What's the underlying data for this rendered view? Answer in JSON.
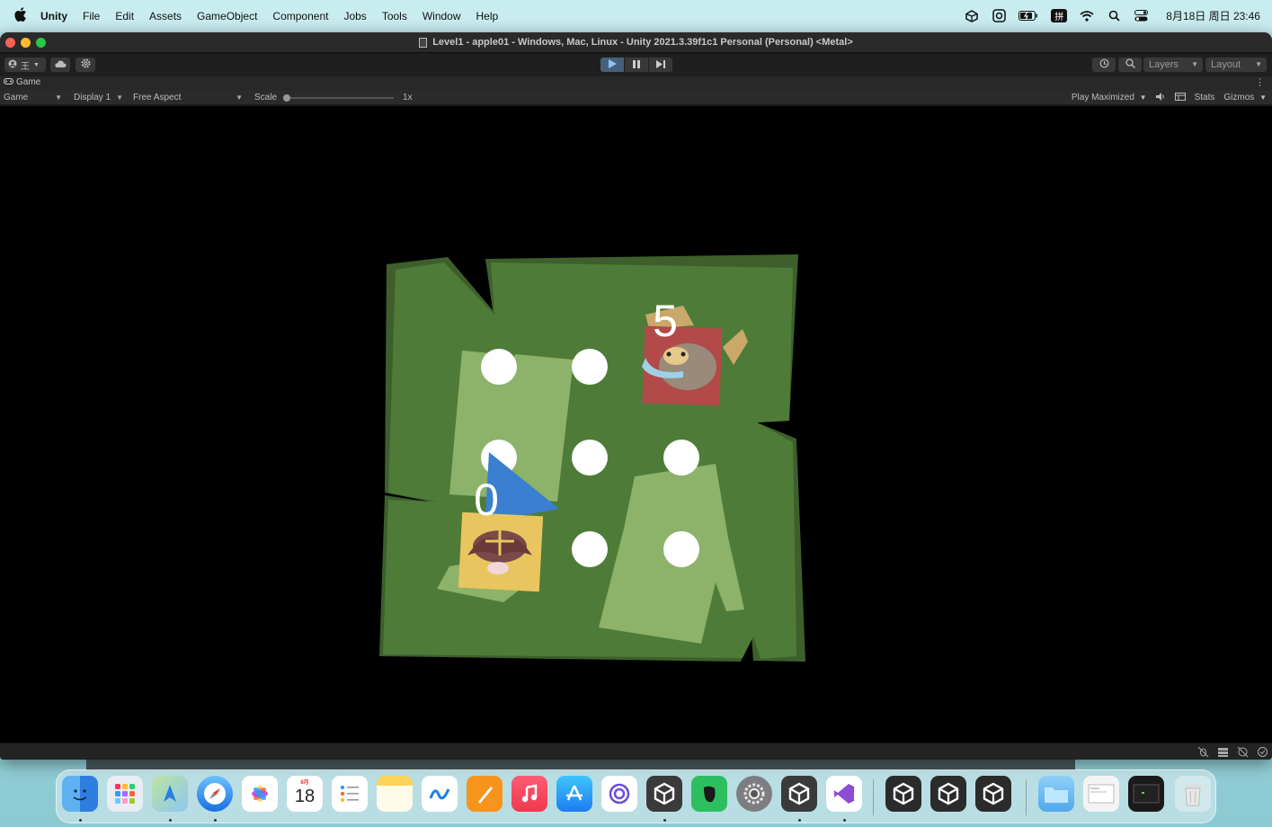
{
  "menubar": {
    "app": "Unity",
    "items": [
      "File",
      "Edit",
      "Assets",
      "GameObject",
      "Component",
      "Jobs",
      "Tools",
      "Window",
      "Help"
    ],
    "status_icons": [
      "unity-hub-icon",
      "screen-record-icon",
      "battery-icon",
      "input-method-icon",
      "wifi-icon",
      "spotlight-search-icon",
      "control-center-icon"
    ],
    "input_method_label": "拼",
    "clock": "8月18日 周日 23:46"
  },
  "window": {
    "title": "Level1 - apple01 - Windows, Mac, Linux - Unity 2021.3.39f1c1 Personal (Personal) <Metal>",
    "toolbar": {
      "account_label": "王",
      "layers_label": "Layers",
      "layout_label": "Layout"
    },
    "tab": {
      "label": "Game"
    },
    "gamebar": {
      "view_select": "Game",
      "display_select": "Display 1",
      "aspect_select": "Free Aspect",
      "scale_label": "Scale",
      "scale_value": "1x",
      "play_mode": "Play Maximized",
      "stats_label": "Stats",
      "gizmos_label": "Gizmos"
    }
  },
  "game": {
    "colors": {
      "board_dark": "#456b31",
      "board_mid": "#4f7f3a",
      "board_light": "#8db26a",
      "node": "#ffffff",
      "arrow": "#3a7fd0",
      "enemy_tile": "#b24a4a",
      "player_tile": "#e8c55f"
    },
    "enemy_counter": "5",
    "player_counter": "0",
    "node_count": 8
  },
  "dock": {
    "calendar_month": "8月",
    "calendar_day": "18",
    "apps": [
      "finder",
      "launchpad",
      "maps",
      "safari",
      "photos",
      "calendar",
      "reminders",
      "notes",
      "freeform",
      "pages",
      "music",
      "app-store",
      "proxyman",
      "unity-hub",
      "evernote",
      "system-settings",
      "unity",
      "visual-studio",
      "unity-editor-1",
      "unity-editor-2",
      "unity-editor-3",
      "downloads",
      "window-preview-1",
      "window-preview-2",
      "trash"
    ]
  }
}
